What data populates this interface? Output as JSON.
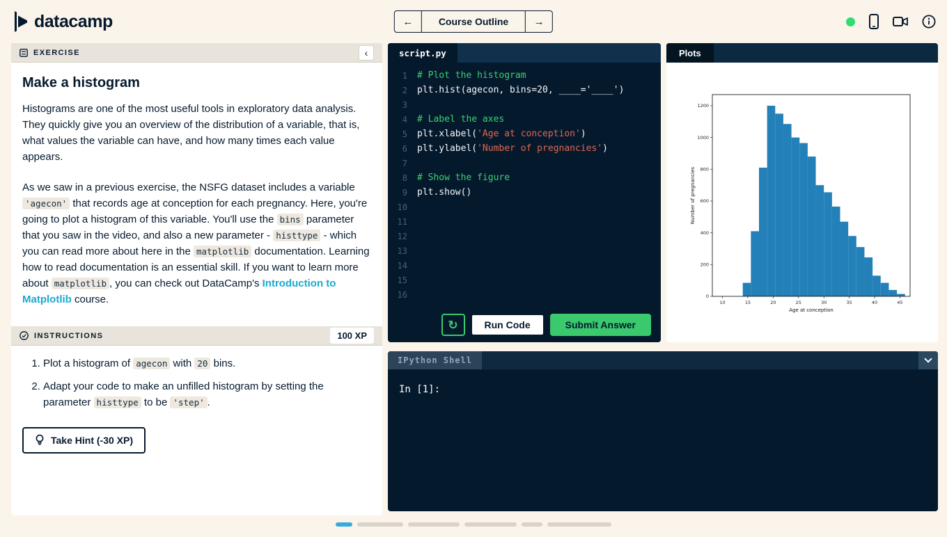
{
  "colors": {
    "navy": "#05192d",
    "page_background": "#fbf4ea",
    "accent_green": "#2edc71",
    "submit_green": "#3ac96d",
    "link_blue": "#19a9d1",
    "histogram_bar_blue": "#2380b8"
  },
  "header": {
    "logo_text": "datacamp",
    "nav": {
      "back": "←",
      "label": "Course Outline",
      "forward": "→"
    }
  },
  "exercise": {
    "panel_label": "EXERCISE",
    "title": "Make a histogram",
    "paragraphs": [
      [
        {
          "t": "Histograms are one of the most useful tools in exploratory data analysis. They quickly give you an overview of the distribution of a variable, that is, what values the variable can have, and how many times each value appears.",
          "s": "plain"
        }
      ],
      [
        {
          "t": "As we saw in a previous exercise, the NSFG dataset includes a variable ",
          "s": "plain"
        },
        {
          "t": "'agecon'",
          "s": "code"
        },
        {
          "t": " that records age at conception for each pregnancy. Here, you're going to plot a histogram of this variable. You'll use the ",
          "s": "plain"
        },
        {
          "t": "bins",
          "s": "code"
        },
        {
          "t": " parameter that you saw in the video, and also a new parameter - ",
          "s": "plain"
        },
        {
          "t": "histtype",
          "s": "code"
        },
        {
          "t": " - which you can read more about here in the ",
          "s": "plain"
        },
        {
          "t": "matplotlib",
          "s": "code"
        },
        {
          "t": " documentation. Learning how to read documentation is an essential skill. If you want to learn more about ",
          "s": "plain"
        },
        {
          "t": "matplotlib",
          "s": "code"
        },
        {
          "t": ", you can check out DataCamp's ",
          "s": "plain"
        },
        {
          "t": "Introduction to Matplotlib",
          "s": "link"
        },
        {
          "t": " course.",
          "s": "plain"
        }
      ]
    ],
    "instructions": {
      "panel_label": "INSTRUCTIONS",
      "xp_badge": "100 XP",
      "items": [
        [
          {
            "t": "Plot a histogram of ",
            "s": "plain"
          },
          {
            "t": "agecon",
            "s": "code"
          },
          {
            "t": " with ",
            "s": "plain"
          },
          {
            "t": "20",
            "s": "code"
          },
          {
            "t": " bins.",
            "s": "plain"
          }
        ],
        [
          {
            "t": "Adapt your code to make an unfilled histogram by setting the parameter ",
            "s": "plain"
          },
          {
            "t": "histtype",
            "s": "code"
          },
          {
            "t": " to be ",
            "s": "plain"
          },
          {
            "t": "'step'",
            "s": "code"
          },
          {
            "t": ".",
            "s": "plain"
          }
        ]
      ]
    },
    "hint_button": "Take Hint (-30 XP)"
  },
  "editor": {
    "tab": "script.py",
    "lines": [
      {
        "n": 1,
        "segs": [
          {
            "t": "# Plot the histogram",
            "s": "comment"
          }
        ]
      },
      {
        "n": 2,
        "segs": [
          {
            "t": "plt.hist(agecon, bins=20, ____='____')",
            "s": "plain"
          }
        ]
      },
      {
        "n": 3,
        "segs": []
      },
      {
        "n": 4,
        "segs": [
          {
            "t": "# Label the axes",
            "s": "comment"
          }
        ]
      },
      {
        "n": 5,
        "segs": [
          {
            "t": "plt.xlabel(",
            "s": "plain"
          },
          {
            "t": "'Age at conception'",
            "s": "string"
          },
          {
            "t": ")",
            "s": "plain"
          }
        ]
      },
      {
        "n": 6,
        "segs": [
          {
            "t": "plt.ylabel(",
            "s": "plain"
          },
          {
            "t": "'Number of pregnancies'",
            "s": "string"
          },
          {
            "t": ")",
            "s": "plain"
          }
        ]
      },
      {
        "n": 7,
        "segs": []
      },
      {
        "n": 8,
        "segs": [
          {
            "t": "# Show the figure",
            "s": "comment"
          }
        ]
      },
      {
        "n": 9,
        "segs": [
          {
            "t": "plt.show()",
            "s": "plain"
          }
        ]
      },
      {
        "n": 10,
        "segs": []
      },
      {
        "n": 11,
        "segs": []
      },
      {
        "n": 12,
        "segs": []
      },
      {
        "n": 13,
        "segs": []
      },
      {
        "n": 14,
        "segs": []
      },
      {
        "n": 15,
        "segs": []
      },
      {
        "n": 16,
        "segs": []
      }
    ],
    "buttons": {
      "reset": "↻",
      "run": "Run Code",
      "submit": "Submit Answer"
    }
  },
  "plots": {
    "tab": "Plots"
  },
  "chart_data": {
    "type": "bar",
    "title": "",
    "xlabel": "Age at conception",
    "ylabel": "Number of pregnancies",
    "bin_start": 14,
    "bin_width": 1.6,
    "values": [
      85,
      410,
      810,
      1200,
      1150,
      1085,
      1000,
      965,
      880,
      700,
      655,
      565,
      470,
      380,
      310,
      245,
      130,
      85,
      40,
      15
    ],
    "xticks": [
      10,
      15,
      20,
      25,
      30,
      35,
      40,
      45
    ],
    "yticks": [
      0,
      200,
      400,
      600,
      800,
      1000,
      1200
    ],
    "xlim": [
      8,
      47
    ],
    "ylim": [
      0,
      1270
    ],
    "grid": false,
    "legend": "none",
    "bar_color": "#2380b8"
  },
  "shell": {
    "tab": "IPython Shell",
    "prompt": "In [1]:"
  },
  "pagination": {
    "active_index": 0,
    "segments": [
      24,
      66,
      74,
      75,
      30,
      92
    ]
  }
}
